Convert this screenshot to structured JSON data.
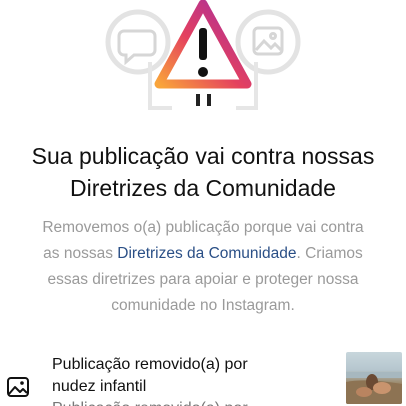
{
  "hero": {
    "icon": "warning-triangle-icon",
    "gradient": [
      "#f9a43a",
      "#e4405f",
      "#c13584",
      "#833ab4"
    ]
  },
  "title": {
    "line1": "Sua publicação vai contra nossas",
    "line2": "Diretrizes da Comunidade"
  },
  "description": {
    "line1": "Removemos o(a) publicação porque vai contra",
    "line2_prefix": "as nossas ",
    "line2_link": "Diretrizes da Comunidade",
    "line2_suffix": ". Criamos",
    "line3": "essas diretrizes para apoiar e proteger nossa",
    "line4": "comunidade no Instagram."
  },
  "removed_item": {
    "icon": "image-icon",
    "line1": "Publicação removido(a) por",
    "line2": "nudez infantil",
    "line3": "Publicação removido(a) por"
  }
}
